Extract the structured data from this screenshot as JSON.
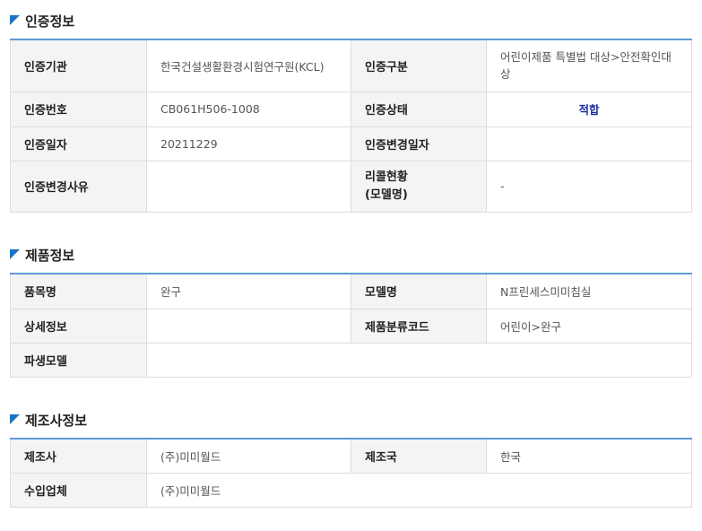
{
  "cert": {
    "title": "인증정보",
    "rows": [
      [
        {
          "label": "인증기관"
        },
        {
          "value": "한국건설생활환경시험연구원(KCL)"
        },
        {
          "label": "인증구분"
        },
        {
          "value": "어린이제품 특별법 대상>안전확인대상"
        }
      ],
      [
        {
          "label": "인증번호"
        },
        {
          "value": "CB061H506-1008"
        },
        {
          "label": "인증상태"
        },
        {
          "value": "적합"
        }
      ],
      [
        {
          "label": "인증일자"
        },
        {
          "value": "20211229"
        },
        {
          "label": "인증변경일자"
        },
        {
          "value": ""
        }
      ],
      [
        {
          "label": "인증변경사유"
        },
        {
          "value": ""
        },
        {
          "label": "리콜현황\n(모델명)"
        },
        {
          "value": "-"
        }
      ]
    ]
  },
  "product": {
    "title": "제품정보",
    "rows": [
      [
        {
          "label": "품목명"
        },
        {
          "value": "완구"
        },
        {
          "label": "모델명"
        },
        {
          "value": "N프린세스미미침실"
        }
      ],
      [
        {
          "label": "상세정보"
        },
        {
          "value": ""
        },
        {
          "label": "제품분류코드"
        },
        {
          "value": "어린이>완구"
        }
      ],
      [
        {
          "label": "파생모델"
        },
        {
          "value": ""
        }
      ]
    ]
  },
  "maker": {
    "title": "제조사정보",
    "rows": [
      [
        {
          "label": "제조사"
        },
        {
          "value": "(주)미미월드"
        },
        {
          "label": "제조국"
        },
        {
          "value": "한국"
        }
      ],
      [
        {
          "label": "수입업체"
        },
        {
          "value": "(주)미미월드"
        }
      ]
    ]
  },
  "colors": {
    "accent": "#1a73c8",
    "table_top_border": "#5e9ad6",
    "label_bg": "#f4f4f4",
    "status_ok": "#1f2e9a"
  }
}
